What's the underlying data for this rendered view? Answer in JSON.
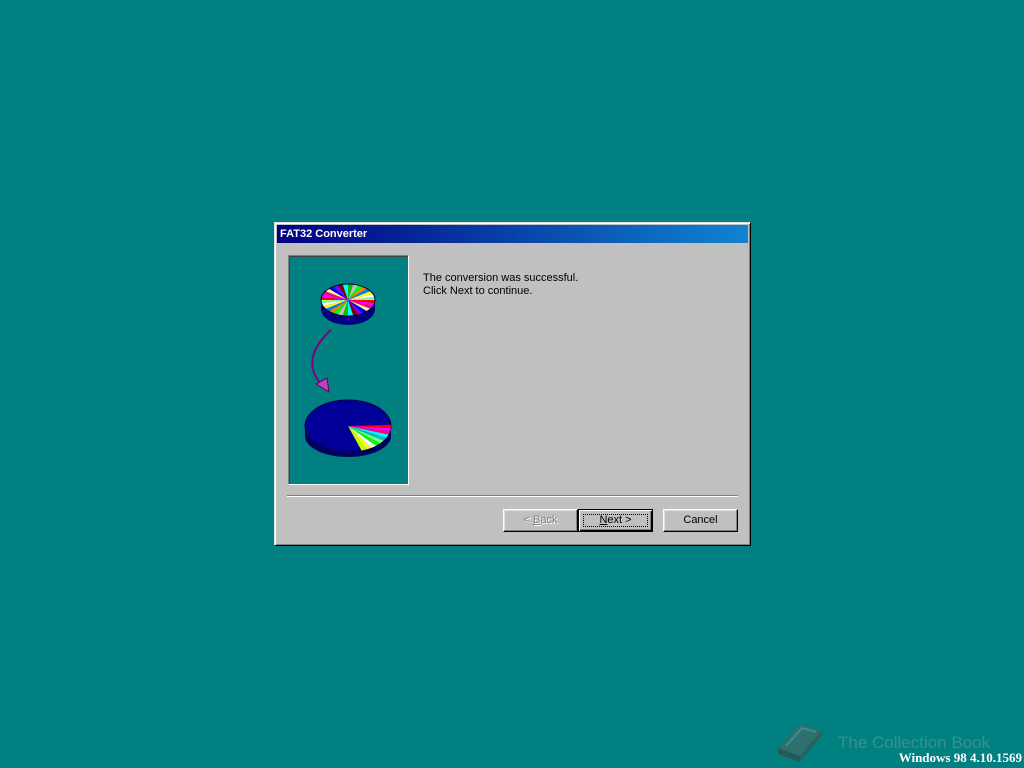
{
  "window": {
    "title": "FAT32 Converter"
  },
  "message": {
    "line1": "The conversion was successful.",
    "line2": "Click Next to continue."
  },
  "buttons": {
    "back": {
      "prefix": "< ",
      "accel": "B",
      "rest": "ack",
      "enabled": false
    },
    "next": {
      "accel": "N",
      "rest": "ext >",
      "default": true
    },
    "cancel": {
      "label": "Cancel"
    }
  },
  "illustration": {
    "top_icon": "small-fragmented-pie-icon",
    "arrow_icon": "curved-arrow-icon",
    "bottom_icon": "large-pie-icon"
  },
  "desktop": {
    "background_color": "#008080",
    "watermark_text": "The Collection Book",
    "version_text": "Windows 98 4.10.1569"
  }
}
